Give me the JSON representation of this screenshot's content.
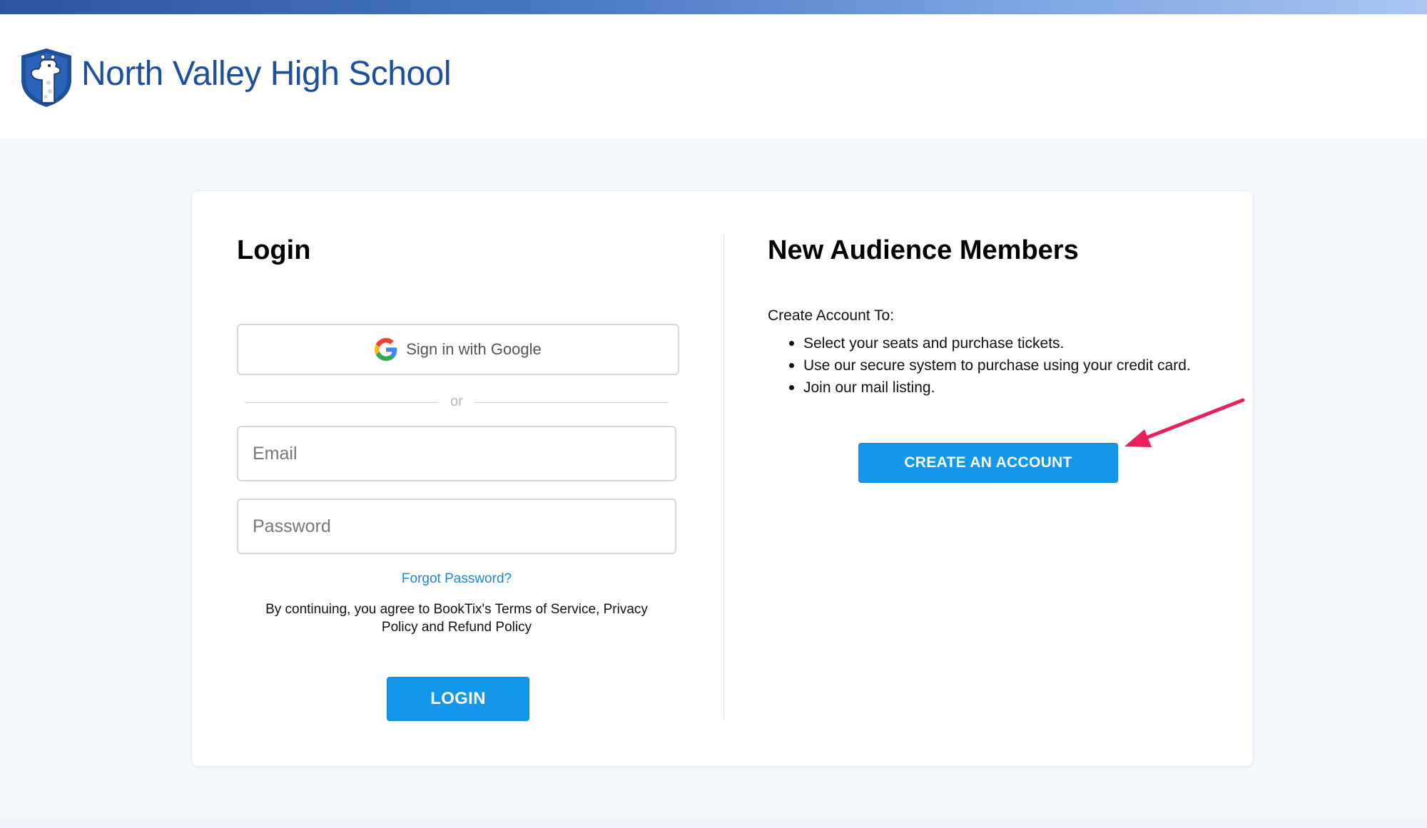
{
  "header": {
    "school_name": "North Valley High School",
    "logo_icon": "giraffe-shield-logo-icon"
  },
  "login": {
    "title": "Login",
    "google_button_label": "Sign in with Google",
    "or_label": "or",
    "email_placeholder": "Email",
    "email_value": "",
    "password_placeholder": "Password",
    "password_value": "",
    "forgot_password_label": "Forgot Password?",
    "terms_text": "By continuing, you agree to BookTix's Terms of Service, Privacy Policy and Refund Policy",
    "login_button_label": "LOGIN"
  },
  "new_members": {
    "title": "New Audience Members",
    "intro": "Create Account To:",
    "bullets": [
      "Select your seats and purchase tickets.",
      "Use our secure system to purchase using your credit card.",
      "Join our mail listing."
    ],
    "create_button_label": "CREATE AN ACCOUNT"
  },
  "colors": {
    "accent": "#1297ea",
    "brand": "#1d4f9b",
    "annotation_arrow": "#e8215a"
  }
}
